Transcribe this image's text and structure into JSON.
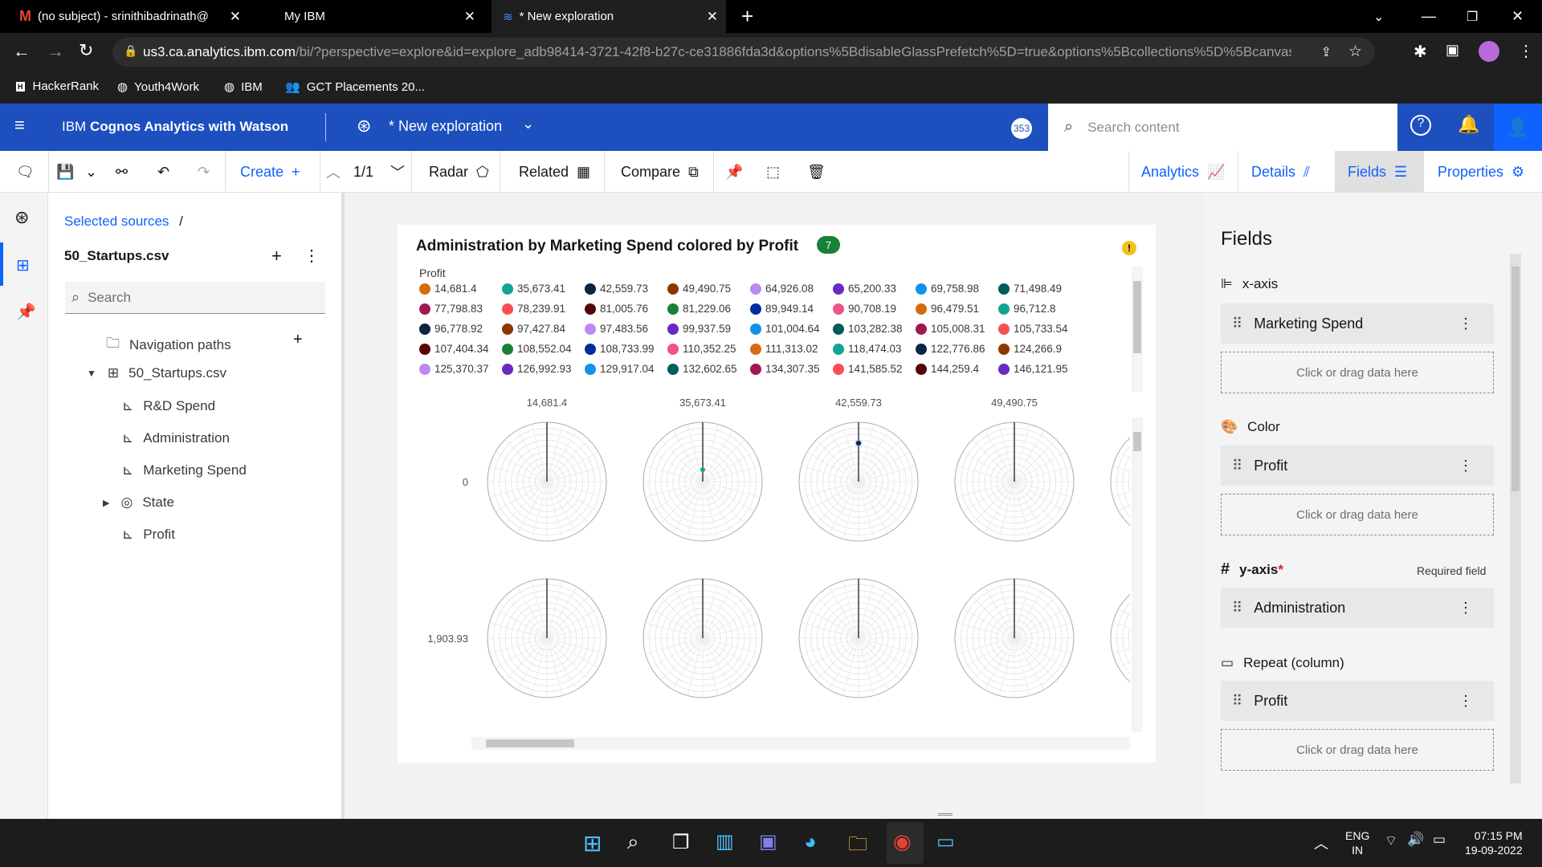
{
  "browser": {
    "tabs": [
      {
        "title": "(no subject) - srinithibadrinath@"
      },
      {
        "title": "My IBM"
      },
      {
        "title": "* New exploration"
      }
    ],
    "url_host": "us3.ca.analytics.ibm.com",
    "url_path": "/bi/?perspective=explore&id=explore_adb98414-3721-42f8-b27c-ce31886fda3d&options%5BdisableGlassPrefetch%5D=true&options%5Bcollections%5D%5Bcanvas...",
    "bookmarks": [
      "HackerRank",
      "Youth4Work",
      "IBM",
      "GCT Placements 20..."
    ]
  },
  "app": {
    "name_prefix": "IBM ",
    "name_bold": "Cognos Analytics with Watson",
    "exploration_title": "* New exploration",
    "badge": "353",
    "search_placeholder": "Search content"
  },
  "toolbar": {
    "create": "Create",
    "page": "1/1",
    "radar": "Radar",
    "related": "Related",
    "compare": "Compare",
    "analytics": "Analytics",
    "details": "Details",
    "fields": "Fields",
    "properties": "Properties"
  },
  "sources": {
    "breadcrumb": "Selected sources",
    "breadcrumb_sep": "/",
    "file": "50_Startups.csv",
    "search_placeholder": "Search",
    "nav_paths": "Navigation paths",
    "table": "50_Startups.csv",
    "columns": [
      "R&D Spend",
      "Administration",
      "Marketing Spend",
      "State",
      "Profit"
    ]
  },
  "chart": {
    "title": "Administration by Marketing Spend colored by Profit",
    "badge": "7",
    "legend_title": "Profit",
    "legend": [
      {
        "label": "14,681.4",
        "color": "#d46c0d"
      },
      {
        "label": "35,673.41",
        "color": "#12a594"
      },
      {
        "label": "42,559.73",
        "color": "#0b2544"
      },
      {
        "label": "49,490.75",
        "color": "#8a3800"
      },
      {
        "label": "64,926.08",
        "color": "#b98af0"
      },
      {
        "label": "65,200.33",
        "color": "#6929c4"
      },
      {
        "label": "69,758.98",
        "color": "#1192e8"
      },
      {
        "label": "71,498.49",
        "color": "#005d5d"
      },
      {
        "label": "77,798.83",
        "color": "#9f1853"
      },
      {
        "label": "78,239.91",
        "color": "#fa4d56"
      },
      {
        "label": "81,005.76",
        "color": "#570408"
      },
      {
        "label": "81,229.06",
        "color": "#198038"
      },
      {
        "label": "89,949.14",
        "color": "#002d9c"
      },
      {
        "label": "90,708.19",
        "color": "#ee538b"
      },
      {
        "label": "96,479.51",
        "color": "#d46c0d"
      },
      {
        "label": "96,712.8",
        "color": "#12a594"
      },
      {
        "label": "96,778.92",
        "color": "#0b2544"
      },
      {
        "label": "97,427.84",
        "color": "#8a3800"
      },
      {
        "label": "97,483.56",
        "color": "#b98af0"
      },
      {
        "label": "99,937.59",
        "color": "#6929c4"
      },
      {
        "label": "101,004.64",
        "color": "#1192e8"
      },
      {
        "label": "103,282.38",
        "color": "#005d5d"
      },
      {
        "label": "105,008.31",
        "color": "#9f1853"
      },
      {
        "label": "105,733.54",
        "color": "#fa4d56"
      },
      {
        "label": "107,404.34",
        "color": "#570408"
      },
      {
        "label": "108,552.04",
        "color": "#198038"
      },
      {
        "label": "108,733.99",
        "color": "#002d9c"
      },
      {
        "label": "110,352.25",
        "color": "#ee538b"
      },
      {
        "label": "111,313.02",
        "color": "#d46c0d"
      },
      {
        "label": "118,474.03",
        "color": "#12a594"
      },
      {
        "label": "122,776.86",
        "color": "#0b2544"
      },
      {
        "label": "124,266.9",
        "color": "#8a3800"
      },
      {
        "label": "125,370.37",
        "color": "#b98af0"
      },
      {
        "label": "126,992.93",
        "color": "#6929c4"
      },
      {
        "label": "129,917.04",
        "color": "#1192e8"
      },
      {
        "label": "132,602.65",
        "color": "#005d5d"
      },
      {
        "label": "134,307.35",
        "color": "#9f1853"
      },
      {
        "label": "141,585.52",
        "color": "#fa4d56"
      },
      {
        "label": "144,259.4",
        "color": "#570408"
      },
      {
        "label": "146,121.95",
        "color": "#6929c4"
      }
    ],
    "column_headers": [
      "14,681.4",
      "35,673.41",
      "42,559.73",
      "49,490.75"
    ],
    "row_headers": [
      "0",
      "1,903.93"
    ]
  },
  "chart_data": {
    "type": "radar",
    "title": "Administration by Marketing Spend colored by Profit",
    "facet_columns": [
      "14,681.4",
      "35,673.41",
      "42,559.73",
      "49,490.75"
    ],
    "facet_rows": [
      "0",
      "1,903.93"
    ]
  },
  "fields_panel": {
    "title": "Fields",
    "xaxis_label": "x-axis",
    "xaxis_field": "Marketing Spend",
    "color_label": "Color",
    "color_field": "Profit",
    "yaxis_label": "y-axis",
    "required_star": "*",
    "required_text": "Required field",
    "yaxis_field": "Administration",
    "repeat_label": "Repeat (column)",
    "repeat_field": "Profit",
    "drop_hint": "Click or drag data here"
  },
  "taskbar": {
    "lang1": "ENG",
    "lang2": "IN",
    "time": "07:15 PM",
    "date": "19-09-2022"
  }
}
